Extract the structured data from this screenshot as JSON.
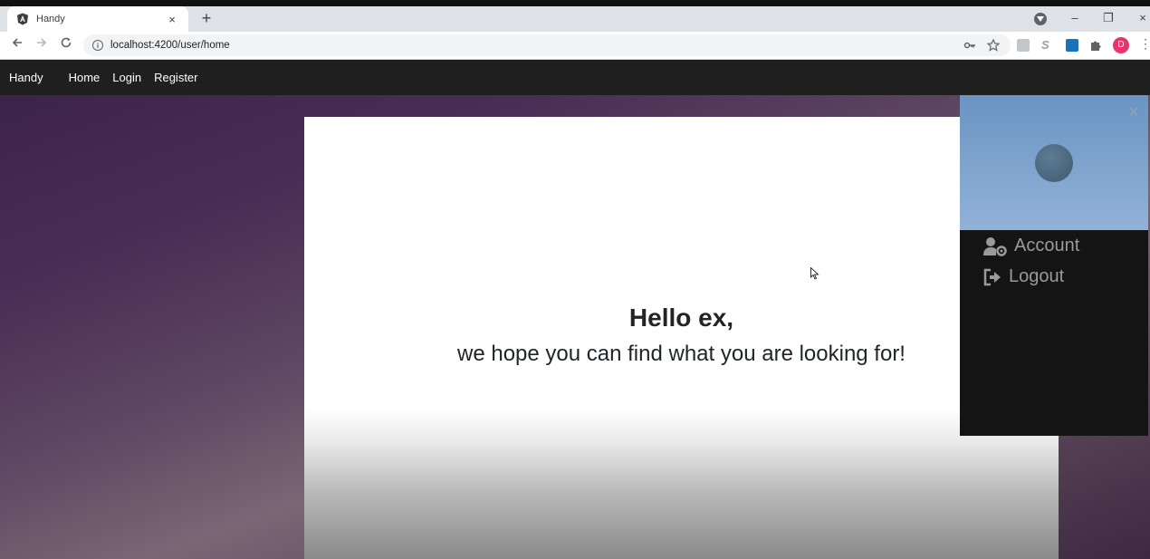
{
  "browser": {
    "tab_title": "Handy",
    "tab_close": "×",
    "new_tab": "+",
    "url": "localhost:4200/user/home",
    "profile_initial": "D",
    "window_controls": {
      "minimize": "–",
      "maximize": "❐",
      "close": "×"
    }
  },
  "app": {
    "brand": "Handy",
    "nav": [
      "Home",
      "Login",
      "Register"
    ]
  },
  "main": {
    "greeting": "Hello ex,",
    "subtitle": "we hope you can find what you are looking for!"
  },
  "sidepanel": {
    "close": "×",
    "items": [
      {
        "label": "Account",
        "icon": "user-cog-icon"
      },
      {
        "label": "Logout",
        "icon": "sign-out-icon"
      }
    ]
  },
  "colors": {
    "navbar": "#1e1f1e",
    "sidepanel": "#141414",
    "sidepanel_header": "#7ea3cd",
    "profile": "#e8336d"
  }
}
